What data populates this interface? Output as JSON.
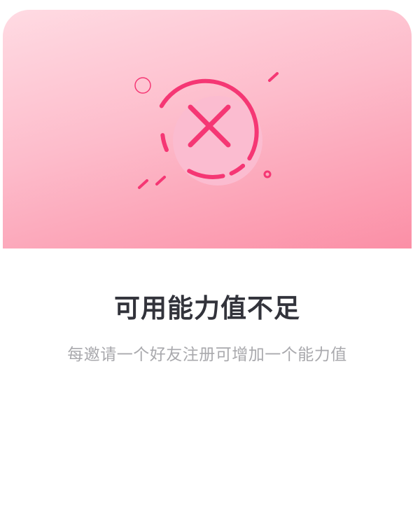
{
  "dialog": {
    "title": "可用能力值不足",
    "message": "每邀请一个好友注册可增加一个能力值",
    "icon": "error-x-icon"
  },
  "colors": {
    "accent": "#f53774",
    "gradient_top": "#ffdbe3",
    "gradient_bottom": "#fb8fa6",
    "title": "#32333b",
    "message": "#a9a9ad"
  }
}
